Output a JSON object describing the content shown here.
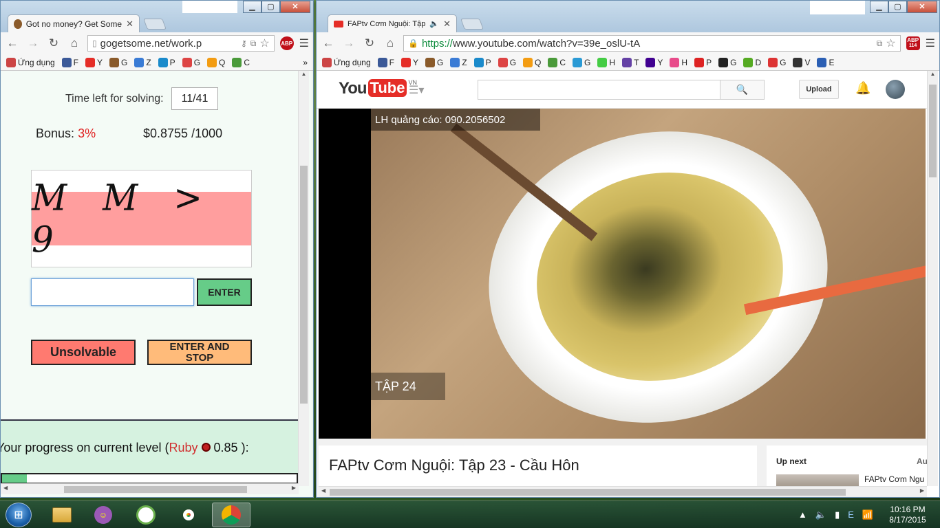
{
  "left_window": {
    "tab_title": "Got no money? Get Some",
    "url": "gogetsome.net/work.p",
    "bookmarks": [
      {
        "label": "Ứng dụng",
        "color": "#c44"
      },
      {
        "label": "F",
        "color": "#3b5998"
      },
      {
        "label": "Y",
        "color": "#e52d27"
      },
      {
        "label": "G",
        "color": "#8a5a2a"
      },
      {
        "label": "Z",
        "color": "#3a7bd5"
      },
      {
        "label": "P",
        "color": "#1a8acb"
      },
      {
        "label": "G",
        "color": "#d44"
      },
      {
        "label": "Q",
        "color": "#f39c12"
      },
      {
        "label": "C",
        "color": "#4a9a3a"
      }
    ],
    "bookmarks_more": "»",
    "time_left_label": "Time left for solving:",
    "time_left_value": "11/41",
    "bonus_label": "Bonus:",
    "bonus_value": "3%",
    "rate": "$0.8755 /1000",
    "captcha_text": "M M > 9",
    "answer_value": "",
    "enter_label": "ENTER",
    "unsolvable_label": "Unsolvable",
    "enter_stop_label": "ENTER AND STOP",
    "progress_text_prefix": "Your progress on current level (",
    "progress_level": "Ruby",
    "progress_value": "0.85",
    "progress_text_suffix": "):",
    "progress_fraction": 0.085
  },
  "right_window": {
    "tab_title": "FAPtv Cơm Nguội: Tập",
    "url_https": "https://",
    "url_rest": "www.youtube.com/watch?v=39e_oslU-tA",
    "abp_count": "114",
    "bookmarks": [
      {
        "label": "Ứng dụng",
        "color": "#c44"
      },
      {
        "label": "F",
        "color": "#3b5998"
      },
      {
        "label": "Y",
        "color": "#e52d27"
      },
      {
        "label": "G",
        "color": "#8a5a2a"
      },
      {
        "label": "Z",
        "color": "#3a7bd5"
      },
      {
        "label": "P",
        "color": "#1a8acb"
      },
      {
        "label": "G",
        "color": "#d44"
      },
      {
        "label": "Q",
        "color": "#f39c12"
      },
      {
        "label": "C",
        "color": "#4a9a3a"
      },
      {
        "label": "G",
        "color": "#2a9ad5"
      },
      {
        "label": "H",
        "color": "#4c4"
      },
      {
        "label": "T",
        "color": "#6441a5"
      },
      {
        "label": "Y",
        "color": "#400090"
      },
      {
        "label": "H",
        "color": "#e84a8a"
      },
      {
        "label": "P",
        "color": "#d22"
      },
      {
        "label": "G",
        "color": "#222"
      },
      {
        "label": "D",
        "color": "#5a2"
      },
      {
        "label": "G",
        "color": "#d33"
      },
      {
        "label": "V",
        "color": "#333"
      },
      {
        "label": "E",
        "color": "#2b5fb4"
      }
    ],
    "yt_logo_you": "You",
    "yt_logo_tube": "Tube",
    "yt_region": "VN",
    "search_value": "",
    "upload_label": "Upload",
    "video_overlay_top": "LH quảng cáo: 090.2056502",
    "video_overlay_bottom": "TẬP 24",
    "video_title": "FAPtv Cơm Nguội: Tập 23 - Cầu Hôn",
    "up_next_label": "Up next",
    "autoplay_label": "Au",
    "up_next_title": "FAPtv Cơm Ngu"
  },
  "taskbar": {
    "time": "10:16 PM",
    "date": "8/17/2015"
  },
  "colors": {
    "bonus_red": "#e02020",
    "enter_green": "#66cc88",
    "unsolvable_red": "#ff7a70",
    "enter_stop_orange": "#ffbb7a",
    "captcha_bg": "#ff9e9e",
    "youtube_red": "#e52d27"
  }
}
